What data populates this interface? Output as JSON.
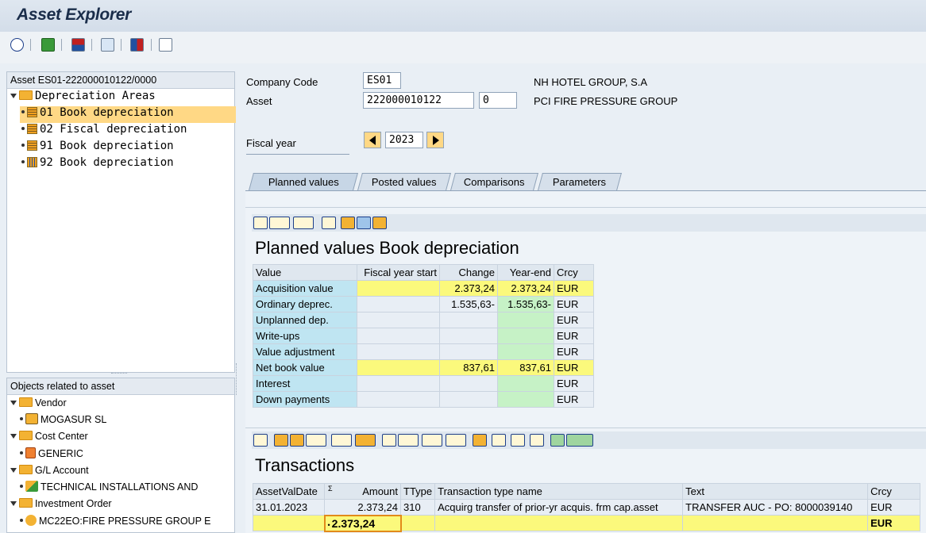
{
  "app": {
    "title": "Asset Explorer"
  },
  "left_tree": {
    "header": "Asset ES01-222000010122/0000",
    "root": "Depreciation Areas",
    "items": [
      {
        "label": "01 Book depreciation",
        "selected": true
      },
      {
        "label": "02 Fiscal depreciation",
        "selected": false
      },
      {
        "label": "91 Book depreciation",
        "selected": false
      },
      {
        "label": "92 Book depreciation",
        "selected": false
      }
    ]
  },
  "related": {
    "header": "Objects related to asset",
    "groups": [
      {
        "label": "Vendor",
        "child": "MOGASUR SL"
      },
      {
        "label": "Cost Center",
        "child": "GENERIC"
      },
      {
        "label": "G/L Account",
        "child": "TECHNICAL INSTALLATIONS AND"
      },
      {
        "label": "Investment Order",
        "child": "MC22EO:FIRE PRESSURE GROUP E"
      }
    ]
  },
  "header_fields": {
    "company_code_label": "Company Code",
    "company_code": "ES01",
    "company_name": "NH HOTEL GROUP, S.A",
    "asset_label": "Asset",
    "asset_main": "222000010122",
    "asset_sub": "0",
    "asset_name": "PCI FIRE PRESSURE GROUP",
    "fiscal_year_label": "Fiscal year",
    "fiscal_year": "2023"
  },
  "tabs": [
    "Planned values",
    "Posted values",
    "Comparisons",
    "Parameters"
  ],
  "planned": {
    "title": "Planned values Book depreciation",
    "columns": [
      "Value",
      "Fiscal year start",
      "Change",
      "Year-end",
      "Crcy"
    ],
    "rows": [
      [
        "Acquisition value",
        "",
        "2.373,24",
        "2.373,24",
        "EUR"
      ],
      [
        "Ordinary deprec.",
        "",
        "1.535,63-",
        "1.535,63-",
        "EUR"
      ],
      [
        "Unplanned dep.",
        "",
        "",
        "",
        "EUR"
      ],
      [
        "Write-ups",
        "",
        "",
        "",
        "EUR"
      ],
      [
        "Value adjustment",
        "",
        "",
        "",
        "EUR"
      ],
      [
        "Net book value",
        "",
        "837,61",
        "837,61",
        "EUR"
      ],
      [
        "Interest",
        "",
        "",
        "",
        "EUR"
      ],
      [
        "Down payments",
        "",
        "",
        "",
        "EUR"
      ]
    ]
  },
  "transactions": {
    "title": "Transactions",
    "columns": [
      "AssetValDate",
      "Σ",
      "Amount",
      "TType",
      "Transaction type name",
      "Text",
      "Crcy"
    ],
    "rows": [
      [
        "31.01.2023",
        "2.373,24",
        "310",
        "Acquirg transfer of prior-yr acquis. frm cap.asset",
        "TRANSFER AUC - PO: 8000039140",
        "EUR"
      ]
    ],
    "total": "2.373,24",
    "total_crcy": "EUR",
    "total_marker": "•"
  },
  "colors": {
    "cyan": "#bfe5f2",
    "yellow": "#fbf97c",
    "green": "#c6f2c6",
    "selected": "#ffd885"
  }
}
